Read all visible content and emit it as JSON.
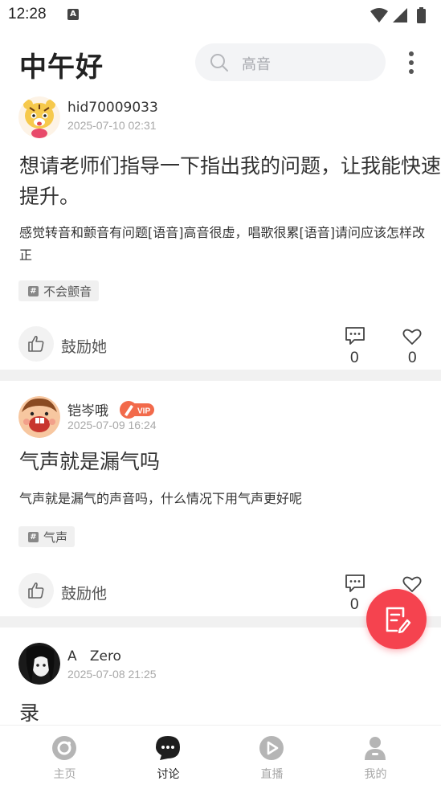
{
  "status_bar": {
    "time": "12:28",
    "notification_badge": "A"
  },
  "header": {
    "greeting": "中午好",
    "search_placeholder": "高音"
  },
  "posts": [
    {
      "author": "hid70009033",
      "time": "2025-07-10 02:31",
      "title": "想请老师们指导一下指出我的问题，让我能快速提升。",
      "body": "感觉转音和颤音有问题[语音]高音很虚，唱歌很累[语音]请问应该怎样改正",
      "tag": "不会颤音",
      "encourage": "鼓励她",
      "comments": "0",
      "likes": "0"
    },
    {
      "author": "铠岑哦",
      "vip": "VIP",
      "time": "2025-07-09 16:24",
      "title": "气声就是漏气吗",
      "body": "气声就是漏气的声音吗，什么情况下用气声更好呢",
      "tag": "气声",
      "encourage": "鼓励他",
      "comments": "0"
    },
    {
      "author": "A   Zero",
      "time": "2025-07-08 21:25",
      "title": "录"
    }
  ],
  "nav": {
    "home": "主页",
    "discuss": "讨论",
    "live": "直播",
    "mine": "我的"
  },
  "colors": {
    "accent": "#f5434f",
    "active_nav": "#222222",
    "inactive_nav": "#a7a7a7"
  }
}
